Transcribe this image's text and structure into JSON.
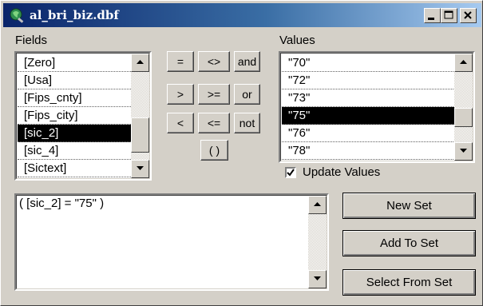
{
  "window": {
    "title": "al_bri_biz.dbf"
  },
  "fields": {
    "label": "Fields",
    "items": [
      "[Zero]",
      "[Usa]",
      "[Fips_cnty]",
      "[Fips_city]",
      "[sic_2]",
      "[sic_4]",
      "[Sictext]"
    ],
    "selected": "[sic_2]"
  },
  "operators": {
    "equals": "=",
    "not_equal": "<>",
    "and": "and",
    "greater": ">",
    "greater_equal": ">=",
    "or": "or",
    "less": "<",
    "less_equal": "<=",
    "not": "not",
    "parens": "( )"
  },
  "values": {
    "label": "Values",
    "items": [
      "\"70\"",
      "\"72\"",
      "\"73\"",
      "\"75\"",
      "\"76\"",
      "\"78\""
    ],
    "selected": "\"75\""
  },
  "update_values": {
    "label": "Update Values",
    "checked": true
  },
  "query": {
    "expression": "( [sic_2] = \"75\" )"
  },
  "actions": {
    "new_set": "New Set",
    "add_to_set": "Add To Set",
    "select_from_set": "Select From Set"
  },
  "icons": {
    "app": "query-builder-icon",
    "minimize": "minimize-icon",
    "maximize": "maximize-icon",
    "close": "close-icon"
  },
  "colors": {
    "titlebar_start": "#0a246a",
    "titlebar_end": "#a6caf0",
    "selection": "#000000",
    "face": "#d4d0c8"
  }
}
